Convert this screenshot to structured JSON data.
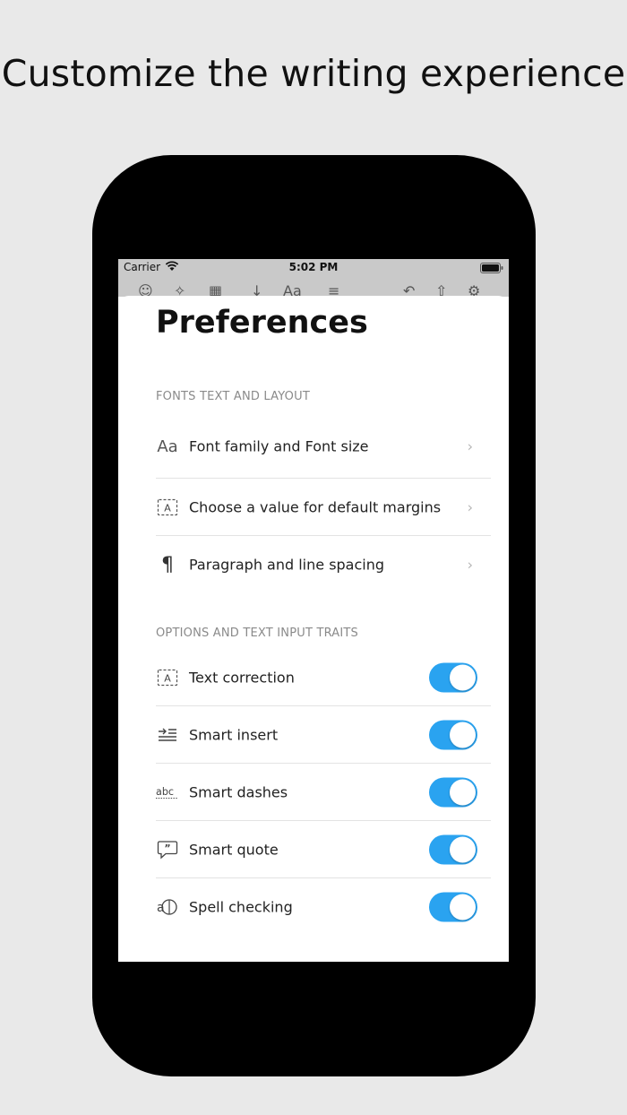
{
  "headline": "Customize the writing experience",
  "status_bar": {
    "carrier": "Carrier",
    "time": "5:02 PM"
  },
  "sheet": {
    "title": "Preferences",
    "sections": [
      {
        "header": "FONTS TEXT AND LAYOUT",
        "rows": [
          {
            "icon": "font-aa-icon",
            "label": "Font family and Font size"
          },
          {
            "icon": "margins-icon",
            "label": "Choose a value for default margins"
          },
          {
            "icon": "pilcrow-icon",
            "label": "Paragraph and line spacing"
          }
        ]
      },
      {
        "header": "OPTIONS AND TEXT INPUT TRAITS",
        "rows": [
          {
            "icon": "text-correction-icon",
            "label": "Text correction",
            "on": true
          },
          {
            "icon": "smart-insert-icon",
            "label": "Smart insert",
            "on": true
          },
          {
            "icon": "smart-dashes-icon",
            "label": "Smart dashes",
            "on": true
          },
          {
            "icon": "smart-quote-icon",
            "label": "Smart quote",
            "on": true
          },
          {
            "icon": "spell-check-icon",
            "label": "Spell checking",
            "on": true
          }
        ]
      }
    ]
  },
  "colors": {
    "toggle_on": "#2aa3f0",
    "background": "#e9e9e9"
  }
}
